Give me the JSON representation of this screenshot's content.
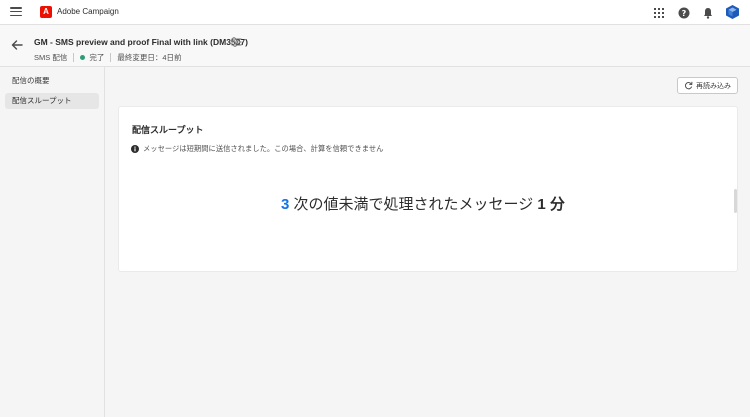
{
  "topbar": {
    "brand_name": "Adobe Campaign",
    "logo_letter": "A",
    "icons": [
      "menu-icon",
      "apps-grid-icon",
      "help-icon",
      "bell-icon",
      "avatar-icon"
    ],
    "brand_color": "#eb1000"
  },
  "header": {
    "title": "GM - SMS preview and proof Final with link (DM3537)",
    "channel": "SMS 配信",
    "status": "完了",
    "last_modified": "最終変更日：4日前",
    "status_color": "#2d9d78"
  },
  "sidebar": {
    "items": [
      {
        "label": "配信の概要",
        "active": false
      },
      {
        "label": "配信スループット",
        "active": true
      }
    ]
  },
  "toolbar": {
    "reload_label": "再読み込み"
  },
  "card": {
    "title": "配信スループット",
    "info_message": "メッセージは短期間に送信されました。この場合、計算を信頼できません",
    "metric_count": "3",
    "metric_text": "次の値未満で処理されたメッセージ",
    "metric_duration": "1 分",
    "accent_color": "#1473e6"
  }
}
